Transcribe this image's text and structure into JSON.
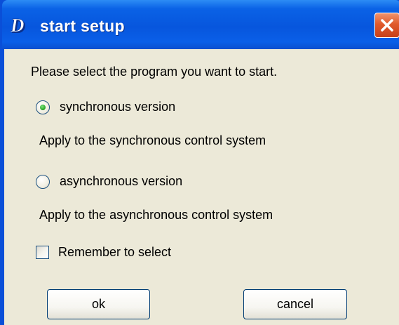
{
  "window": {
    "title": "start setup",
    "logo_letter": "D"
  },
  "prompt": "Please select the program you want to start.",
  "options": [
    {
      "label": "synchronous version",
      "selected": true,
      "description": "Apply to the synchronous control system"
    },
    {
      "label": "asynchronous version",
      "selected": false,
      "description": "Apply to the asynchronous control system"
    }
  ],
  "remember": {
    "label": "Remember to select",
    "checked": false
  },
  "buttons": {
    "ok": "ok",
    "cancel": "cancel"
  },
  "icons": {
    "logo": "app-logo-icon",
    "close": "close-icon"
  },
  "colors": {
    "titlebar": "#0756dd",
    "close": "#e05a2c",
    "client": "#ece9d8",
    "radio_selected": "#21a121"
  }
}
